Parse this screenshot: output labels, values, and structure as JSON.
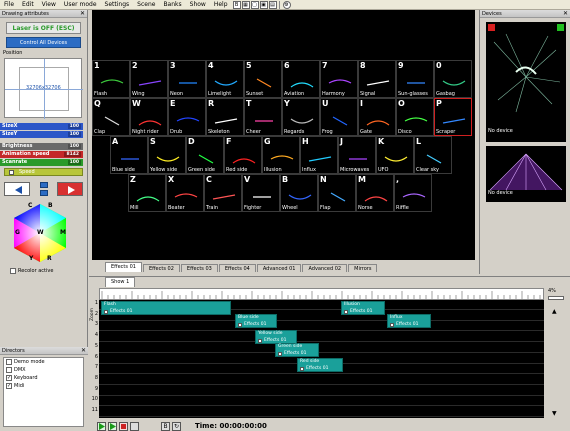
{
  "menu": {
    "items": [
      "File",
      "Edit",
      "View",
      "User mode",
      "Settings",
      "Scene",
      "Banks",
      "Show",
      "Help"
    ]
  },
  "left": {
    "title": "Drawing attributes",
    "laser_button": "Laser is OFF (ESC)",
    "control_all": "Control All Devices",
    "position_label": "Position",
    "position_value": "32706x32706",
    "params": [
      {
        "label": "SizeX",
        "value": "100",
        "color": "#2c56c8",
        "val_color": "#1e3f9a"
      },
      {
        "label": "SizeY",
        "value": "100",
        "color": "#2c56c8",
        "val_color": "#1e3f9a"
      },
      {
        "label": "Brightness",
        "value": "100",
        "color": "#6a6a6a",
        "val_color": "#505050"
      },
      {
        "label": "Animation speed",
        "value": "8142",
        "color": "#c42828",
        "val_color": "#8a1a1a"
      },
      {
        "label": "Scanrate",
        "value": "100",
        "color": "#2a9a2a",
        "val_color": "#1a6a1a"
      }
    ],
    "speed_label": "Speed",
    "hex_labels": {
      "c": "C",
      "b": "B",
      "m": "M",
      "r": "R",
      "y": "Y",
      "g": "G",
      "w": "W"
    },
    "recolor_label": "Recolor active",
    "directors_title": "Directors",
    "directors": [
      {
        "label": "Demo mode",
        "checked": ""
      },
      {
        "label": "DMX",
        "checked": ""
      },
      {
        "label": "Keyboard",
        "checked": "✓"
      },
      {
        "label": "Midi",
        "checked": "✓"
      }
    ]
  },
  "effects": {
    "cells": [
      {
        "key": "1",
        "name": "Flash",
        "color": "#3cc83c"
      },
      {
        "key": "2",
        "name": "Wing",
        "color": "#8844ff"
      },
      {
        "key": "3",
        "name": "Neon",
        "color": "#2288ff"
      },
      {
        "key": "4",
        "name": "Limelight",
        "color": "#22aaff"
      },
      {
        "key": "5",
        "name": "Sunset",
        "color": "#ff8822"
      },
      {
        "key": "6",
        "name": "Aviation",
        "color": "#22ddff"
      },
      {
        "key": "7",
        "name": "Harmony",
        "color": "#aa44ff"
      },
      {
        "key": "8",
        "name": "Signal",
        "color": "#ffffff"
      },
      {
        "key": "9",
        "name": "Sun-glasses",
        "color": "#3388ff"
      },
      {
        "key": "0",
        "name": "Gasbag",
        "color": "#33cc88"
      },
      {
        "key": "Q",
        "name": "Clap",
        "color": "#dddddd"
      },
      {
        "key": "W",
        "name": "Night rider",
        "color": "#ff3333"
      },
      {
        "key": "E",
        "name": "Drub",
        "color": "#2244ff"
      },
      {
        "key": "R",
        "name": "Skeleton",
        "color": "#ffffff"
      },
      {
        "key": "T",
        "name": "Cheer",
        "color": "#ff44aa"
      },
      {
        "key": "Y",
        "name": "Regards",
        "color": "#bbbbbb"
      },
      {
        "key": "U",
        "name": "Frog",
        "color": "#2266ff"
      },
      {
        "key": "I",
        "name": "Gate",
        "color": "#ff6622"
      },
      {
        "key": "O",
        "name": "Disco",
        "color": "#44ff44"
      },
      {
        "key": "P",
        "name": "Scraper",
        "color": "#3388ff"
      },
      {
        "key": "A",
        "name": "Blue side",
        "color": "#3366ff"
      },
      {
        "key": "S",
        "name": "Yellow side",
        "color": "#ffee22"
      },
      {
        "key": "D",
        "name": "Green side",
        "color": "#22ff44"
      },
      {
        "key": "F",
        "name": "Red side",
        "color": "#ff2222"
      },
      {
        "key": "G",
        "name": "Illusion",
        "color": "#ffaa22"
      },
      {
        "key": "H",
        "name": "Influx",
        "color": "#22ccff"
      },
      {
        "key": "J",
        "name": "Microwaves",
        "color": "#aa44ff"
      },
      {
        "key": "K",
        "name": "UFO",
        "color": "#ffee33"
      },
      {
        "key": "L",
        "name": "Clear sky",
        "color": "#44ccff"
      },
      {
        "key": "Z",
        "name": "Mill",
        "color": "#44ff88"
      },
      {
        "key": "X",
        "name": "Beater",
        "color": "#ff4444"
      },
      {
        "key": "C",
        "name": "Train",
        "color": "#ff5555"
      },
      {
        "key": "V",
        "name": "Fighter",
        "color": "#ffffff"
      },
      {
        "key": "B",
        "name": "Wheel",
        "color": "#3366ff"
      },
      {
        "key": "N",
        "name": "Flap",
        "color": "#44aaff"
      },
      {
        "key": "M",
        "name": "Norse",
        "color": "#ff4444"
      },
      {
        "key": ",",
        "name": "Riffle",
        "color": "#aa66ff"
      }
    ],
    "tabs": [
      "Effects 01",
      "Effects 02",
      "Effects 03",
      "Effects 04",
      "Advanced 01",
      "Advanced 02",
      "Mirrors"
    ]
  },
  "devices": {
    "title": "Devices",
    "items": [
      {
        "label": "No device"
      },
      {
        "label": "No device"
      }
    ]
  },
  "timeline": {
    "tab": "Show 1",
    "zoom_label": "Zoom",
    "zoom_value": "4%",
    "rows": [
      "1",
      "2",
      "3",
      "4",
      "5",
      "6",
      "7",
      "8",
      "9",
      "10",
      "11"
    ],
    "clips": [
      {
        "title": "Flash",
        "sub": "Effects 01"
      },
      {
        "title": "Illusion",
        "sub": "Effects 01"
      },
      {
        "title": "Blue side",
        "sub": "Effects 01"
      },
      {
        "title": "Influx",
        "sub": "Effects 01"
      },
      {
        "title": "Yellow side",
        "sub": "Effects 01"
      },
      {
        "title": "Green side",
        "sub": "Effects 01"
      },
      {
        "title": "Red side",
        "sub": "Effects 01"
      }
    ],
    "time_label": "Time: 00:00:00:00"
  }
}
